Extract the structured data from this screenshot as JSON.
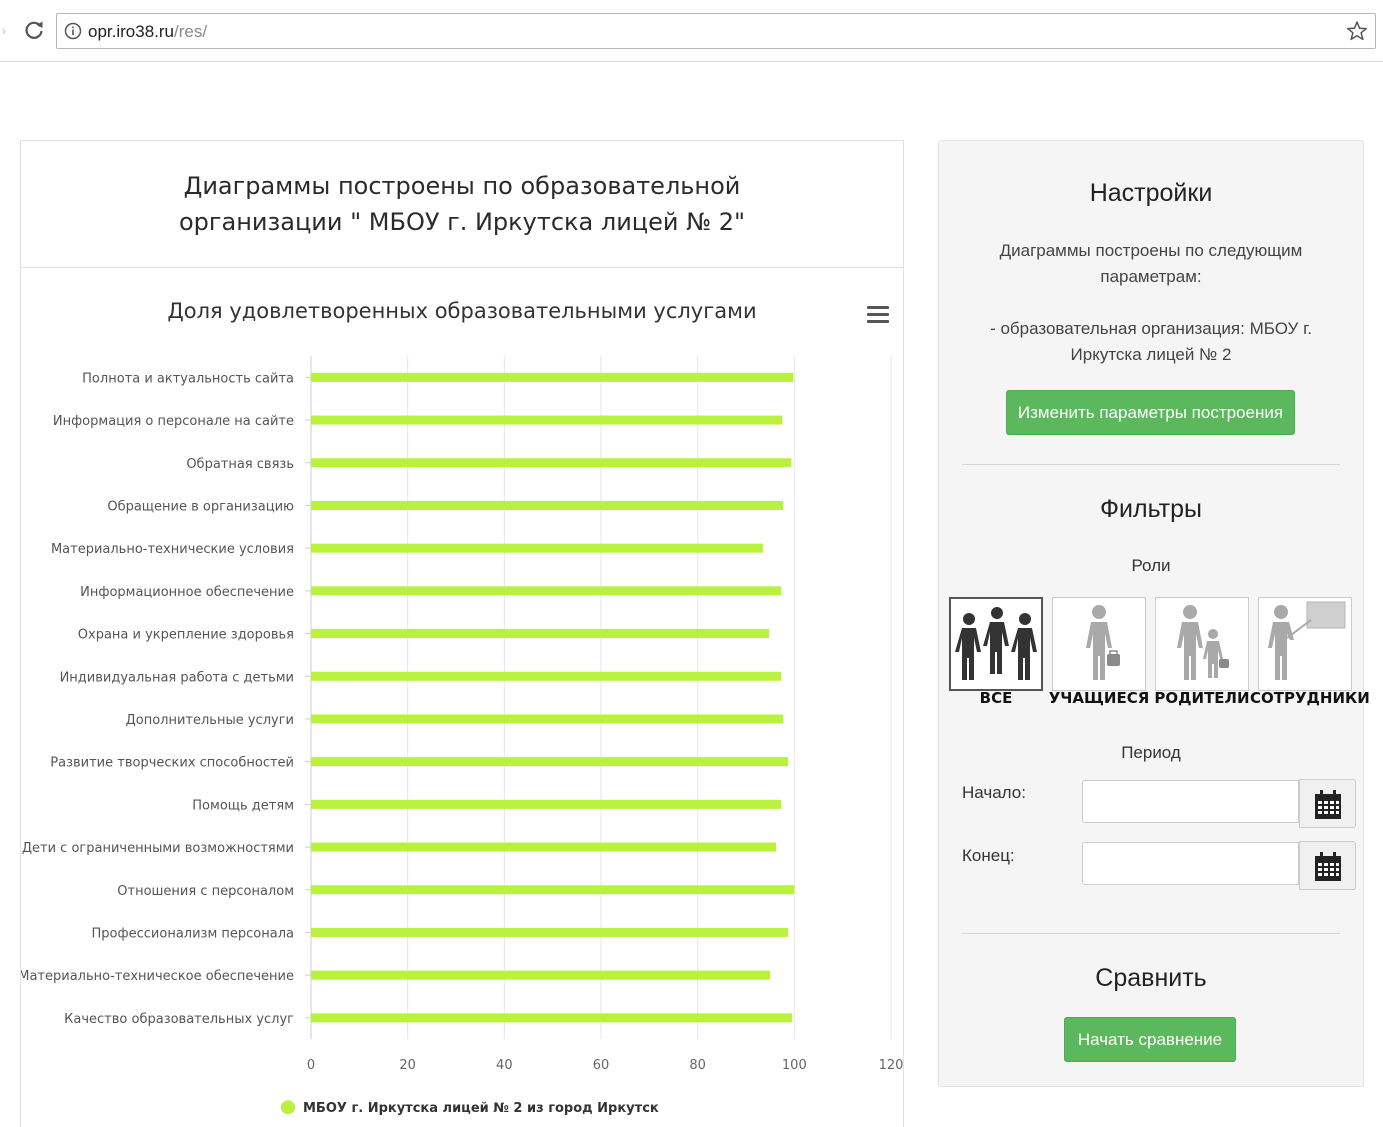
{
  "browser": {
    "url_host": "opr.iro38.ru",
    "url_path": "/res/"
  },
  "main": {
    "heading": "Диаграммы построены по образовательной организации \" МБОУ г. Иркутска лицей № 2\""
  },
  "chart_data": {
    "type": "bar",
    "orientation": "horizontal",
    "title": "Доля удовлетворенных образовательными услугами",
    "xlabel": "",
    "ylabel": "",
    "xlim": [
      0,
      120
    ],
    "x_ticks": [
      "0",
      "20",
      "40",
      "60",
      "80",
      "100",
      "120"
    ],
    "grid": true,
    "legend_position": "bottom",
    "categories": [
      "Полнота и актуальность сайта",
      "Информация о персонале на сайте",
      "Обратная связь",
      "Обращение в организацию",
      "Материально-технические условия",
      "Информационное обеспечение",
      "Охрана и укрепление здоровья",
      "Индивидуальная работа с детьми",
      "Дополнительные услуги",
      "Развитие творческих способностей",
      "Помощь детям",
      "Дети с ограниченными возможностями",
      "Отношения с персоналом",
      "Профессионализм персонала",
      "Материально-техническое обеспечение",
      "Качество образовательных услуг"
    ],
    "series": [
      {
        "name": "МБОУ г. Иркутска лицей № 2 из город Иркутск",
        "color": "#b8f23c",
        "values": [
          99.8,
          97.5,
          99.4,
          97.7,
          93.5,
          97.3,
          94.8,
          97.3,
          97.7,
          98.7,
          97.3,
          96.2,
          100,
          98.7,
          95,
          99.5
        ]
      }
    ]
  },
  "settings": {
    "title": "Настройки",
    "desc": "Диаграммы построены по следующим параметрам:",
    "org": "- образовательная организация: МБОУ г. Иркутска лицей № 2",
    "change_button": "Изменить параметры построения"
  },
  "filters": {
    "title": "Фильтры",
    "roles_label": "Роли",
    "roles": [
      {
        "label": "ВСЕ",
        "icon": "group-all-icon",
        "active": true
      },
      {
        "label": "УЧАЩИЕСЯ",
        "icon": "student-icon",
        "active": false
      },
      {
        "label": "РОДИТЕЛИ",
        "icon": "parent-child-icon",
        "active": false
      },
      {
        "label": "СОТРУДНИКИ",
        "icon": "teacher-board-icon",
        "active": false
      }
    ],
    "period_label": "Период",
    "start_label": "Начало:",
    "end_label": "Конец:",
    "start_value": "",
    "end_value": ""
  },
  "compare": {
    "title": "Сравнить",
    "button": "Начать сравнение"
  },
  "colors": {
    "accent_green": "#5cb85c",
    "bar": "#b8f23c"
  }
}
